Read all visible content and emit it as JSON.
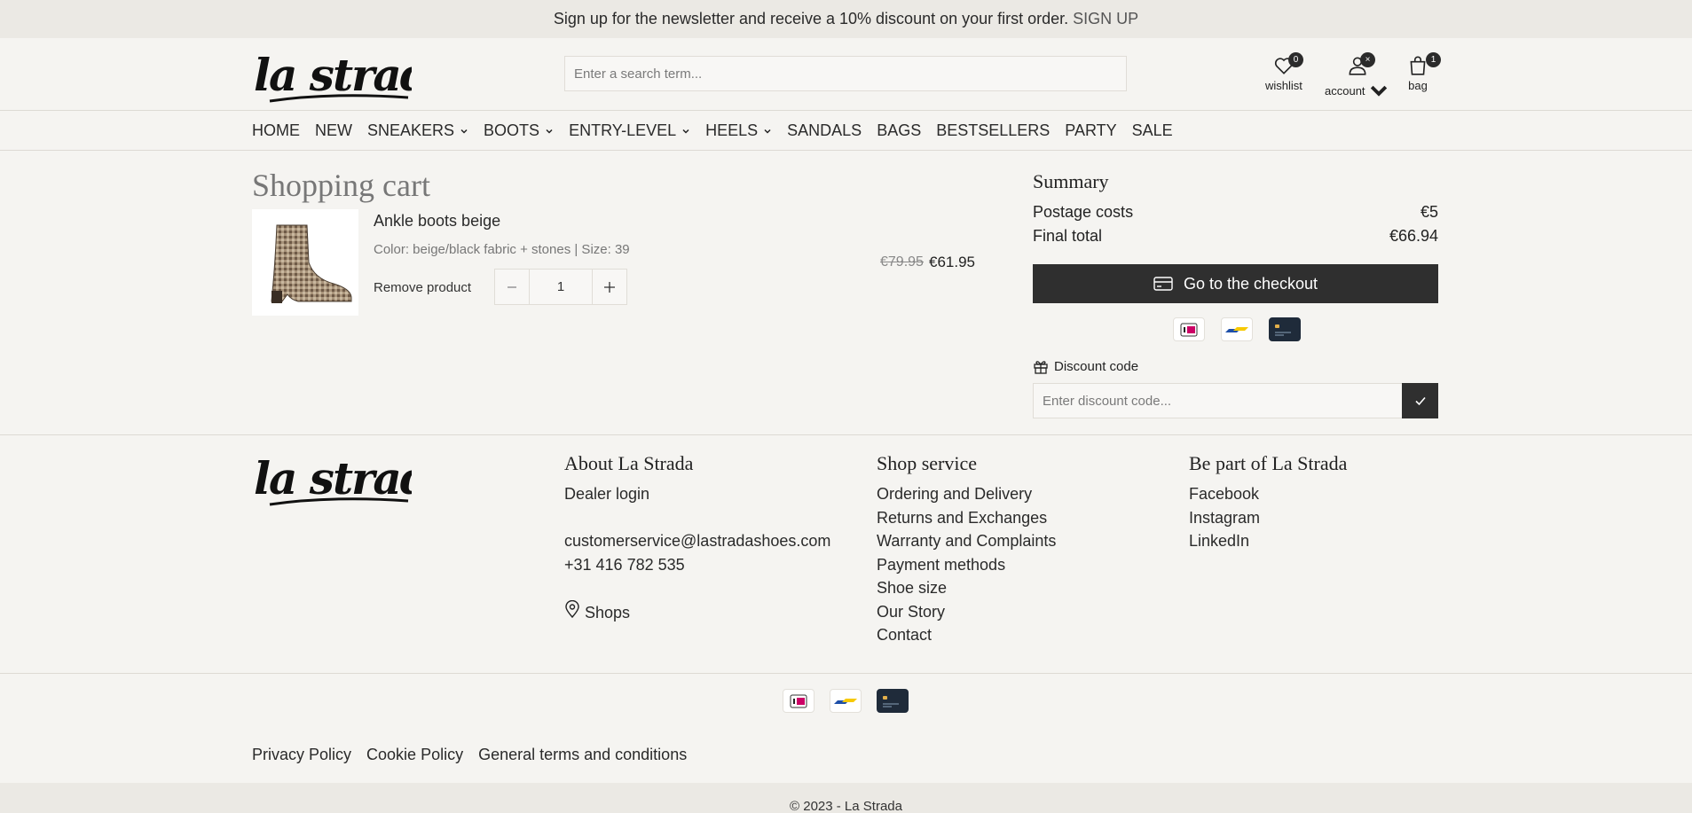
{
  "banner": {
    "text": "Sign up for the newsletter and receive a 10% discount on your first order.",
    "link": "SIGN UP"
  },
  "header": {
    "logo_text": "la strada",
    "search_placeholder": "Enter a search term...",
    "wishlist": {
      "label": "wishlist",
      "count": "0"
    },
    "account": {
      "label": "account",
      "badge": "×"
    },
    "bag": {
      "label": "bag",
      "count": "1"
    }
  },
  "nav": {
    "items": [
      {
        "label": "HOME",
        "dropdown": false
      },
      {
        "label": "NEW",
        "dropdown": false
      },
      {
        "label": "SNEAKERS",
        "dropdown": true
      },
      {
        "label": "BOOTS",
        "dropdown": true
      },
      {
        "label": "ENTRY-LEVEL",
        "dropdown": true
      },
      {
        "label": "HEELS",
        "dropdown": true
      },
      {
        "label": "SANDALS",
        "dropdown": false
      },
      {
        "label": "BAGS",
        "dropdown": false
      },
      {
        "label": "BESTSELLERS",
        "dropdown": false
      },
      {
        "label": "PARTY",
        "dropdown": false
      },
      {
        "label": "SALE",
        "dropdown": false
      }
    ]
  },
  "cart": {
    "title": "Shopping cart",
    "product": {
      "name": "Ankle boots beige",
      "meta": "Color: beige/black fabric + stones | Size: 39",
      "remove_label": "Remove product",
      "quantity": "1",
      "old_price": "€79.95",
      "new_price": "€61.95"
    }
  },
  "summary": {
    "title": "Summary",
    "postage_label": "Postage costs",
    "postage_value": "€5",
    "total_label": "Final total",
    "total_value": "€66.94",
    "checkout_label": "Go to the checkout",
    "discount_label": "Discount code",
    "discount_placeholder": "Enter discount code..."
  },
  "payment_icons": [
    "ideal-icon",
    "bancontact-icon",
    "credit-card-icon"
  ],
  "footer": {
    "logo_text": "la strada",
    "about": {
      "title": "About La Strada",
      "dealer": "Dealer login",
      "email": "customerservice@lastradashoes.com",
      "phone": "+31 416 782 535",
      "shops": "Shops"
    },
    "service": {
      "title": "Shop service",
      "links": [
        "Ordering and Delivery",
        "Returns and Exchanges",
        "Warranty and Complaints",
        "Payment methods",
        "Shoe size",
        "Our Story",
        "Contact"
      ]
    },
    "social": {
      "title": "Be part of La Strada",
      "links": [
        "Facebook",
        "Instagram",
        "LinkedIn"
      ]
    },
    "legal": [
      "Privacy Policy",
      "Cookie Policy",
      "General terms and conditions"
    ],
    "copyright": "© 2023 - La Strada"
  },
  "colors": {
    "dark_button": "#2f2f2f",
    "background": "#f5f4f1",
    "banner": "#ebe9e4"
  }
}
